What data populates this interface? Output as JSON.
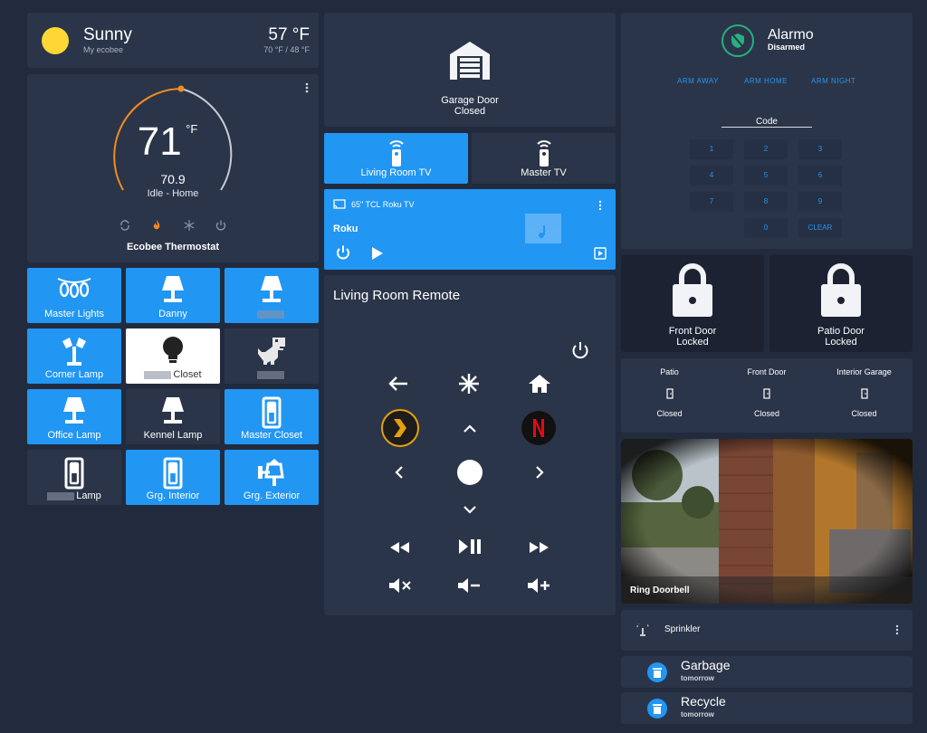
{
  "weather": {
    "condition": "Sunny",
    "source": "My ecobee",
    "temp": "57 °F",
    "range": "70 °F / 48 °F",
    "icon": "sun-icon"
  },
  "thermostat": {
    "setpoint": "71",
    "unit": "°F",
    "current": "70.9",
    "status": "Idle - Home",
    "name": "Ecobee Thermostat",
    "modes": [
      "auto-mode-icon",
      "heat-mode-icon",
      "cool-mode-icon",
      "power-icon"
    ]
  },
  "light_tiles": [
    {
      "label": "Master Lights",
      "icon": "string-lights-icon",
      "state": "on"
    },
    {
      "label": "Danny",
      "icon": "lamp-icon",
      "state": "on"
    },
    {
      "label": "",
      "icon": "lamp-icon",
      "state": "on"
    },
    {
      "label": "Corner Lamp",
      "icon": "floor-lamp-icon",
      "state": "on"
    },
    {
      "label": "Closet",
      "icon": "bulb-icon",
      "state": "highlight"
    },
    {
      "label": "",
      "icon": "dino-icon",
      "state": "off"
    },
    {
      "label": "Office Lamp",
      "icon": "lamp-icon",
      "state": "on"
    },
    {
      "label": "Kennel Lamp",
      "icon": "lamp-icon",
      "state": "off"
    },
    {
      "label": "Master Closet",
      "icon": "switch-icon",
      "state": "on"
    },
    {
      "label": "Lamp",
      "icon": "switch-icon",
      "state": "off"
    },
    {
      "label": "Grg. Interior",
      "icon": "switch-icon",
      "state": "on"
    },
    {
      "label": "Grg. Exterior",
      "icon": "outdoor-lamp-icon",
      "state": "on"
    }
  ],
  "garage": {
    "name": "Garage Door",
    "state": "Closed"
  },
  "tv_tabs": [
    {
      "label": "Living Room TV",
      "active": true
    },
    {
      "label": "Master TV",
      "active": false
    }
  ],
  "media": {
    "device": "65\" TCL Roku TV",
    "source": "Roku"
  },
  "remote": {
    "title": "Living Room Remote"
  },
  "alarm": {
    "name": "Alarmo",
    "state": "Disarmed",
    "buttons": [
      "ARM AWAY",
      "ARM HOME",
      "ARM NIGHT"
    ],
    "code_label": "Code",
    "keys": [
      "1",
      "2",
      "3",
      "4",
      "5",
      "6",
      "7",
      "8",
      "9",
      "0",
      "CLEAR"
    ]
  },
  "locks": [
    {
      "name": "Front Door",
      "state": "Locked"
    },
    {
      "name": "Patio Door",
      "state": "Locked"
    }
  ],
  "doors": [
    {
      "name": "Patio",
      "state": "Closed"
    },
    {
      "name": "Front Door",
      "state": "Closed"
    },
    {
      "name": "Interior Garage",
      "state": "Closed"
    }
  ],
  "camera": {
    "name": "Ring Doorbell"
  },
  "sprinkler": {
    "name": "Sprinkler"
  },
  "reminders": [
    {
      "name": "Garbage",
      "when": "tomorrow"
    },
    {
      "name": "Recycle",
      "when": "tomorrow"
    }
  ],
  "colors": {
    "accent": "#2196f3",
    "card": "#2b3549",
    "background": "#222b3d",
    "heat": "#f28c1e",
    "sun": "#fdd835"
  }
}
